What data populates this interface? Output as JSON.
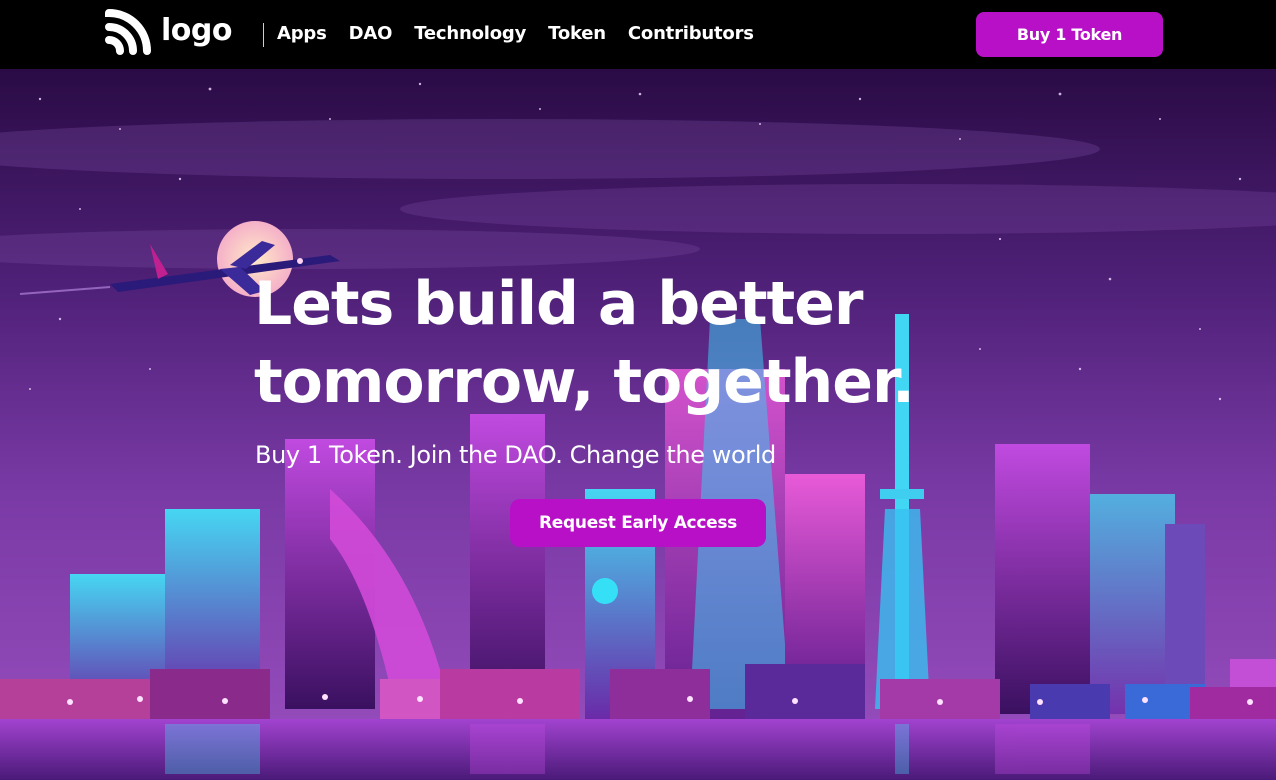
{
  "nav": {
    "logo_text": "logo",
    "links": [
      {
        "label": "Apps"
      },
      {
        "label": "DAO"
      },
      {
        "label": "Technology"
      },
      {
        "label": "Token"
      },
      {
        "label": "Contributors"
      }
    ],
    "cta_label": "Buy 1 Token"
  },
  "hero": {
    "headline_line1": "Lets build a better",
    "headline_line2": "tomorrow, together.",
    "subline": "Buy 1 Token. Join the DAO. Change the world",
    "cta_label": "Request Early Access",
    "background_scene": "neon-city-night-skyline-with-airplane-and-moon"
  },
  "colors": {
    "accent": "#b710c7",
    "nav_bg": "#000000",
    "text": "#ffffff"
  },
  "icons": {
    "logo_mark": "signal-arcs-icon"
  }
}
